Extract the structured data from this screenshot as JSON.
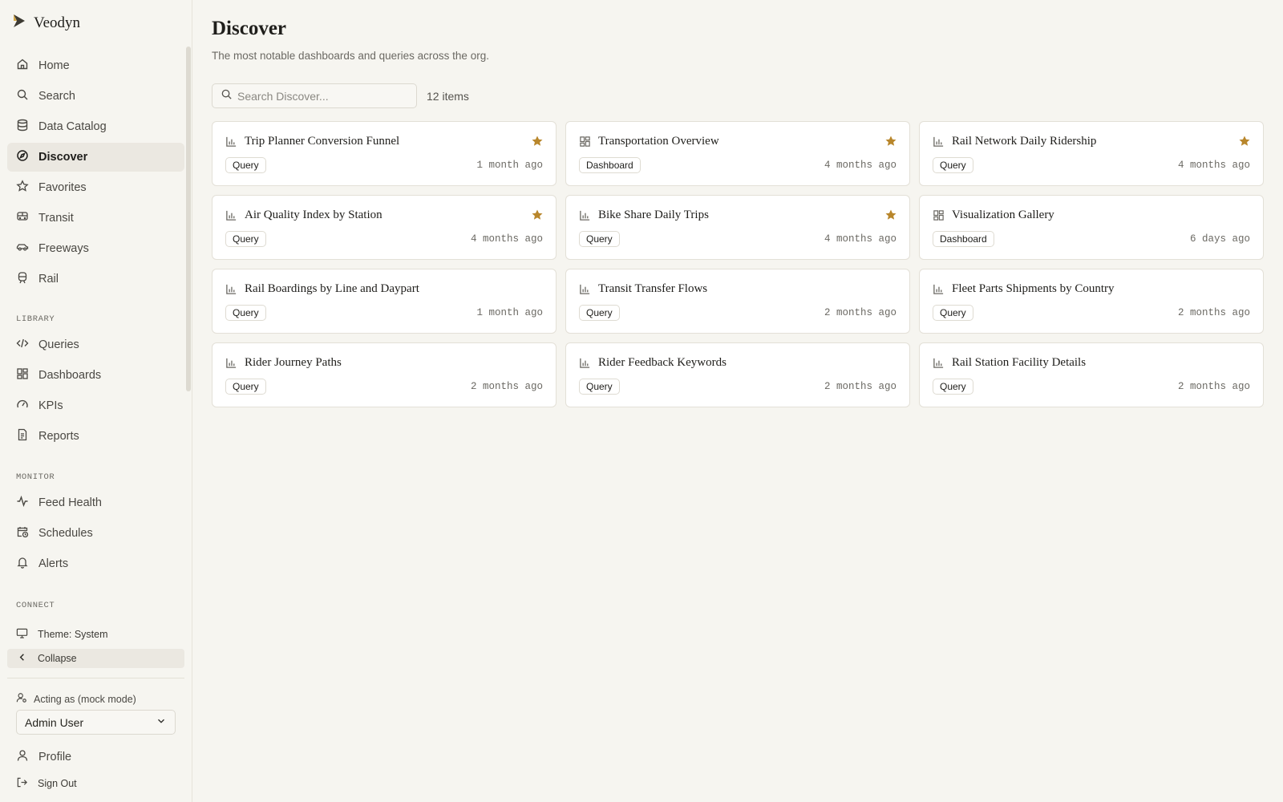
{
  "app": {
    "name": "Veodyn"
  },
  "sidebar": {
    "main_items": [
      {
        "label": "Home",
        "icon": "home-icon"
      },
      {
        "label": "Search",
        "icon": "search-icon"
      },
      {
        "label": "Data Catalog",
        "icon": "database-icon"
      },
      {
        "label": "Discover",
        "icon": "compass-icon",
        "active": true
      },
      {
        "label": "Favorites",
        "icon": "star-icon"
      },
      {
        "label": "Transit",
        "icon": "bus-icon"
      },
      {
        "label": "Freeways",
        "icon": "car-icon"
      },
      {
        "label": "Rail",
        "icon": "train-icon"
      }
    ],
    "library_label": "LIBRARY",
    "library_items": [
      {
        "label": "Queries",
        "icon": "code-icon"
      },
      {
        "label": "Dashboards",
        "icon": "dashboard-icon"
      },
      {
        "label": "KPIs",
        "icon": "gauge-icon"
      },
      {
        "label": "Reports",
        "icon": "report-icon"
      }
    ],
    "monitor_label": "MONITOR",
    "monitor_items": [
      {
        "label": "Feed Health",
        "icon": "activity-icon"
      },
      {
        "label": "Schedules",
        "icon": "calendar-clock-icon"
      },
      {
        "label": "Alerts",
        "icon": "bell-icon"
      }
    ],
    "connect_label": "CONNECT",
    "theme_label": "Theme: System",
    "collapse_label": "Collapse",
    "acting_as_label": "Acting as (mock mode)",
    "acting_user": "Admin User",
    "profile_label": "Profile",
    "sign_out_label": "Sign Out"
  },
  "main": {
    "title": "Discover",
    "subtitle": "The most notable dashboards and queries across the org.",
    "search_placeholder": "Search Discover...",
    "item_count": "12 items",
    "accent_star_color": "#b8862b",
    "cards": [
      {
        "title": "Trip Planner Conversion Funnel",
        "type": "Query",
        "time": "1 month ago",
        "starred": true,
        "icon": "bar-chart-icon"
      },
      {
        "title": "Transportation Overview",
        "type": "Dashboard",
        "time": "4 months ago",
        "starred": true,
        "icon": "dashboard-icon"
      },
      {
        "title": "Rail Network Daily Ridership",
        "type": "Query",
        "time": "4 months ago",
        "starred": true,
        "icon": "bar-chart-icon"
      },
      {
        "title": "Air Quality Index by Station",
        "type": "Query",
        "time": "4 months ago",
        "starred": true,
        "icon": "bar-chart-icon"
      },
      {
        "title": "Bike Share Daily Trips",
        "type": "Query",
        "time": "4 months ago",
        "starred": true,
        "icon": "bar-chart-icon"
      },
      {
        "title": "Visualization Gallery",
        "type": "Dashboard",
        "time": "6 days ago",
        "starred": false,
        "icon": "dashboard-icon"
      },
      {
        "title": "Rail Boardings by Line and Daypart",
        "type": "Query",
        "time": "1 month ago",
        "starred": false,
        "icon": "bar-chart-icon"
      },
      {
        "title": "Transit Transfer Flows",
        "type": "Query",
        "time": "2 months ago",
        "starred": false,
        "icon": "bar-chart-icon"
      },
      {
        "title": "Fleet Parts Shipments by Country",
        "type": "Query",
        "time": "2 months ago",
        "starred": false,
        "icon": "bar-chart-icon"
      },
      {
        "title": "Rider Journey Paths",
        "type": "Query",
        "time": "2 months ago",
        "starred": false,
        "icon": "bar-chart-icon"
      },
      {
        "title": "Rider Feedback Keywords",
        "type": "Query",
        "time": "2 months ago",
        "starred": false,
        "icon": "bar-chart-icon"
      },
      {
        "title": "Rail Station Facility Details",
        "type": "Query",
        "time": "2 months ago",
        "starred": false,
        "icon": "bar-chart-icon"
      }
    ]
  }
}
